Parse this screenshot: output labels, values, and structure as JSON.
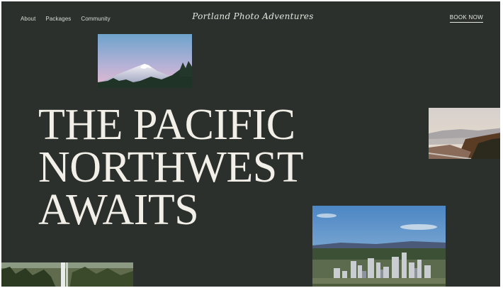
{
  "nav": {
    "items": [
      {
        "label": "About"
      },
      {
        "label": "Packages"
      },
      {
        "label": "Community"
      }
    ]
  },
  "brand": {
    "name": "Portland Photo Adventures"
  },
  "cta": {
    "book_label": "BOOK NOW"
  },
  "hero": {
    "lines": [
      "THE PACIFIC",
      "NORTHWEST",
      "AWAITS"
    ]
  },
  "colors": {
    "background": "#2b302c",
    "text": "#f1efe7"
  }
}
